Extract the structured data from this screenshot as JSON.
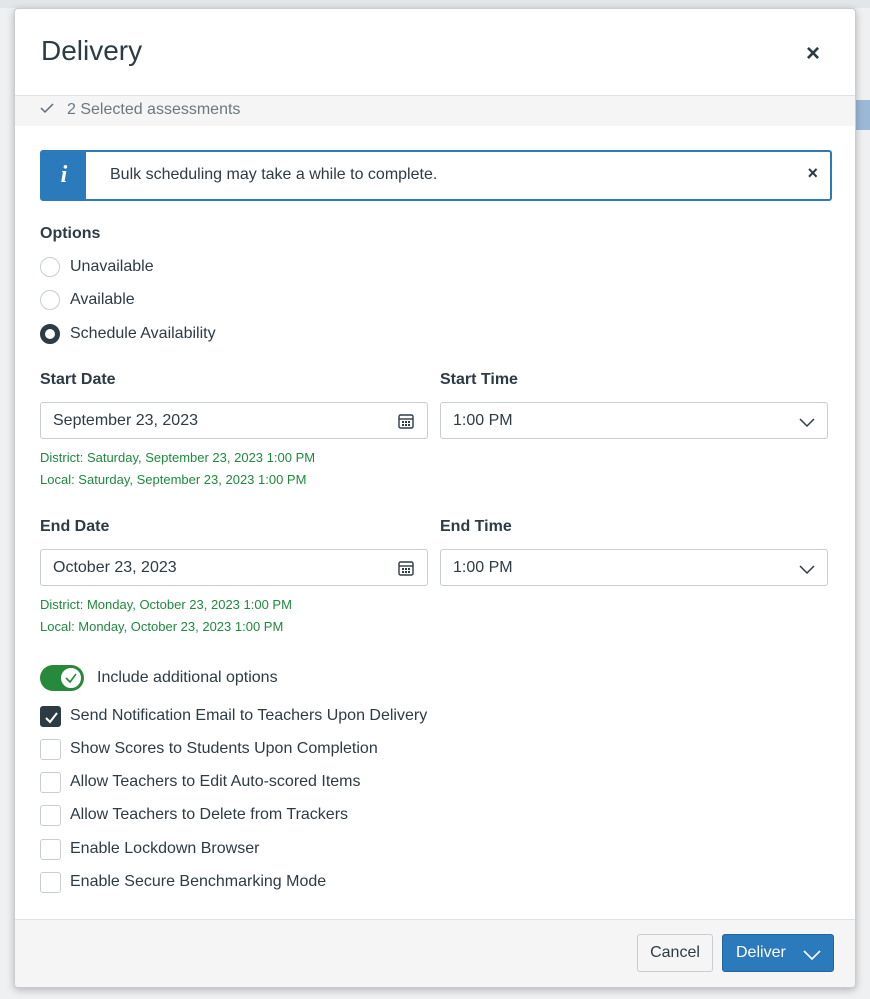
{
  "modal": {
    "title": "Delivery",
    "close_label": "×",
    "selected_text": "2 Selected assessments"
  },
  "alert": {
    "icon_letter": "i",
    "text": "Bulk scheduling may take a while to complete.",
    "close_label": "×"
  },
  "options": {
    "label": "Options",
    "items": [
      {
        "label": "Unavailable",
        "checked": false
      },
      {
        "label": "Available",
        "checked": false
      },
      {
        "label": "Schedule Availability",
        "checked": true
      }
    ]
  },
  "start": {
    "date_label": "Start Date",
    "date_value": "September 23, 2023",
    "time_label": "Start Time",
    "time_value": "1:00 PM",
    "district_hint": "District: Saturday, September 23, 2023 1:00 PM",
    "local_hint": "Local: Saturday, September 23, 2023 1:00 PM"
  },
  "end": {
    "date_label": "End Date",
    "date_value": "October 23, 2023",
    "time_label": "End Time",
    "time_value": "1:00 PM",
    "district_hint": "District: Monday, October 23, 2023 1:00 PM",
    "local_hint": "Local: Monday, October 23, 2023 1:00 PM"
  },
  "additional": {
    "toggle_label": "Include additional options",
    "toggle_on": true,
    "checkboxes": [
      {
        "label": "Send Notification Email to Teachers Upon Delivery",
        "checked": true
      },
      {
        "label": "Show Scores to Students Upon Completion",
        "checked": false
      },
      {
        "label": "Allow Teachers to Edit Auto-scored Items",
        "checked": false
      },
      {
        "label": "Allow Teachers to Delete from Trackers",
        "checked": false
      },
      {
        "label": "Enable Lockdown Browser",
        "checked": false
      },
      {
        "label": "Enable Secure Benchmarking Mode",
        "checked": false
      }
    ]
  },
  "footer": {
    "cancel_label": "Cancel",
    "deliver_label": "Deliver"
  },
  "colors": {
    "primary": "#2b7abc",
    "success_text": "#1e8a3c",
    "toggle_on": "#27893c",
    "text": "#2d3b45"
  }
}
